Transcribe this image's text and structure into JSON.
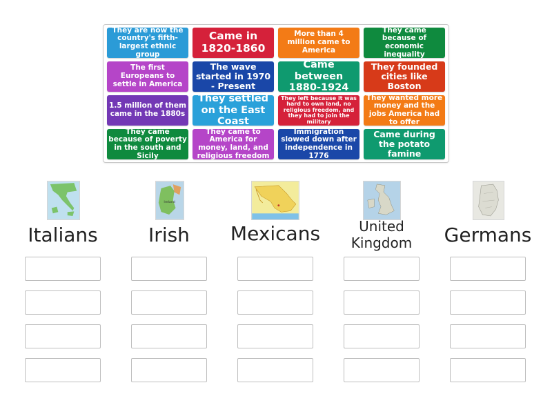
{
  "cards": [
    {
      "text": "They are now the country's fifth-largest ethnic group",
      "color": "#2b9bd7"
    },
    {
      "text": "Came in 1820-1860",
      "color": "#d5213a"
    },
    {
      "text": "More than 4 million came to America",
      "color": "#f37b16"
    },
    {
      "text": "They came because of economic inequality",
      "color": "#0f8a3e"
    },
    {
      "text": "The first Europeans to settle in America",
      "color": "#b545c8"
    },
    {
      "text": "The wave started in 1970 - Present",
      "color": "#1a47a8"
    },
    {
      "text": "Came between 1880-1924",
      "color": "#0f9a6f"
    },
    {
      "text": "They founded cities like Boston",
      "color": "#d73a19"
    },
    {
      "text": "1.5 million of them came in the 1880s",
      "color": "#7338b5"
    },
    {
      "text": "They settled on the East Coast",
      "color": "#2aa1da"
    },
    {
      "text": "They left because it was hard to own land, no religious freedom, and they had to join the military",
      "color": "#d5213a"
    },
    {
      "text": "They wanted more money and the jobs America had to offer",
      "color": "#f37b16"
    },
    {
      "text": "They came because of poverty in the south and Sicily",
      "color": "#0f8a3e"
    },
    {
      "text": "They came to America for money, land, and religious freedom",
      "color": "#b545c8"
    },
    {
      "text": "Immigration slowed down after independence in 1776",
      "color": "#1a47a8"
    },
    {
      "text": "Came during the potato famine",
      "color": "#0f9a6f"
    }
  ],
  "columns": [
    {
      "title": "Italians",
      "image": "italy-map-thumbnail"
    },
    {
      "title": "Irish",
      "image": "ireland-map-thumbnail"
    },
    {
      "title": "Mexicans",
      "image": "mexico-map-thumbnail"
    },
    {
      "title": "United Kingdom",
      "image": "uk-map-thumbnail"
    },
    {
      "title": "Germans",
      "image": "germany-map-thumbnail"
    }
  ]
}
